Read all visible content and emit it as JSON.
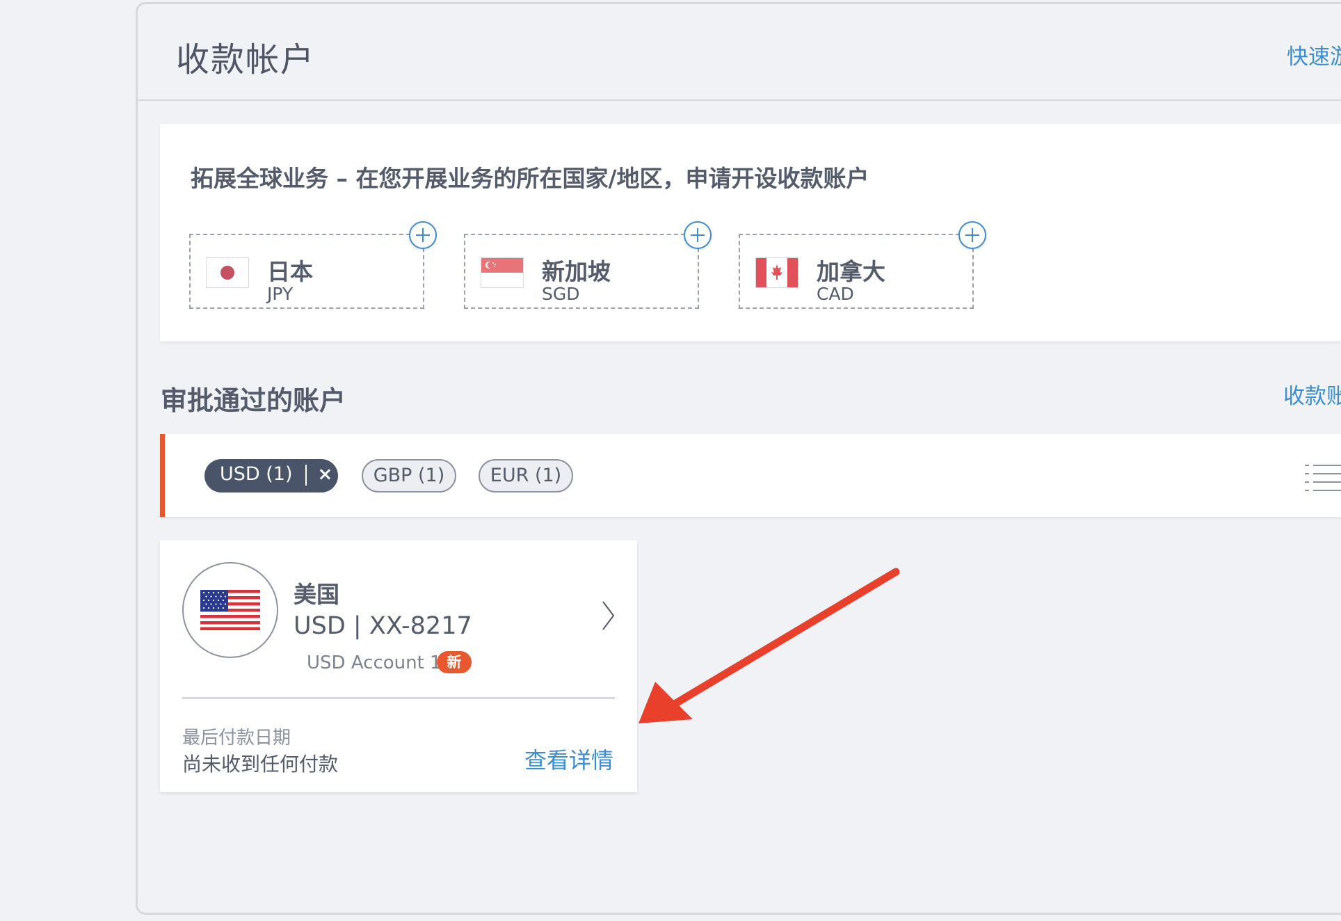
{
  "page": {
    "title": "收款帐户",
    "top_link": "快速游"
  },
  "expand": {
    "title": "拓展全球业务 – 在您开展业务的所在国家/地区，申请开设收款账户",
    "countries": [
      {
        "name": "日本",
        "code": "JPY",
        "flag": "japan-flag"
      },
      {
        "name": "新加坡",
        "code": "SGD",
        "flag": "singapore-flag"
      },
      {
        "name": "加拿大",
        "code": "CAD",
        "flag": "canada-flag"
      }
    ]
  },
  "approved": {
    "title": "审批通过的账户",
    "link": "收款账"
  },
  "filters": {
    "chips": [
      {
        "label": "USD (1)",
        "active": true,
        "remove_label": "×"
      },
      {
        "label": "GBP (1)",
        "active": false
      },
      {
        "label": "EUR (1)",
        "active": false
      }
    ]
  },
  "account": {
    "country": "美国",
    "number": "USD | XX-8217",
    "name": "USD Account 1",
    "badge": "新",
    "last_payment_label": "最后付款日期",
    "last_payment_value": "尚未收到任何付款",
    "details_link": "查看详情"
  },
  "colors": {
    "accent": "#e8582f",
    "link": "#3d8dd3",
    "chip_active": "#4a5468",
    "annotation_arrow": "#e8402a"
  }
}
